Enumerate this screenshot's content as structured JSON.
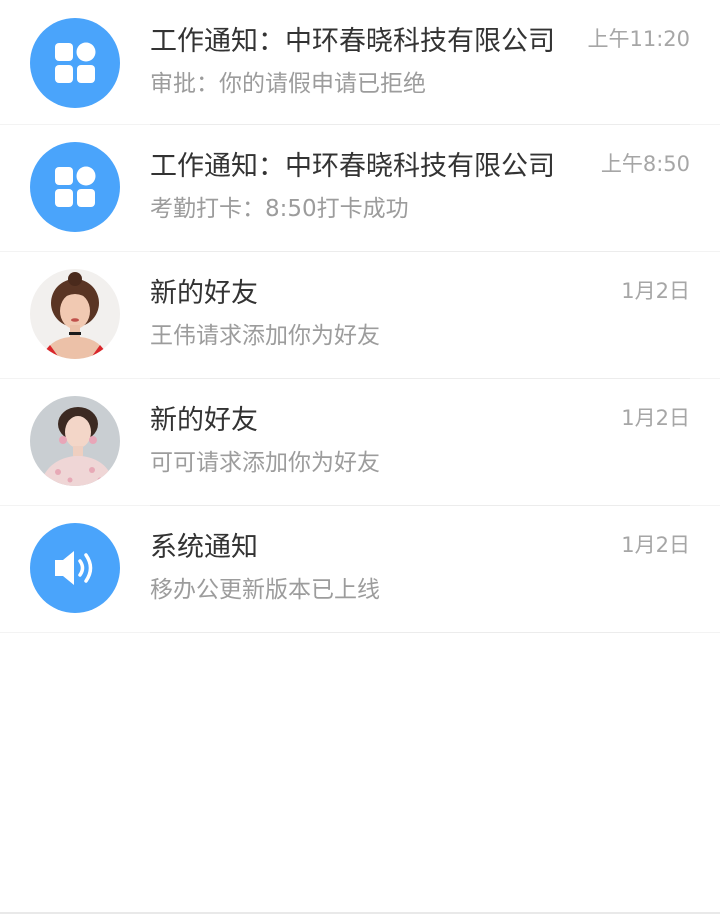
{
  "messages": [
    {
      "title": "工作通知：中环春晓科技有限公司",
      "time": "上午11:20",
      "subtitle": "审批：你的请假申请已拒绝",
      "avatar_icon": "apps-grid-icon",
      "avatar_color": "#4aa4fb"
    },
    {
      "title": "工作通知：中环春晓科技有限公司",
      "time": "上午8:50",
      "subtitle": "考勤打卡：8:50打卡成功",
      "avatar_icon": "apps-grid-icon",
      "avatar_color": "#4aa4fb"
    },
    {
      "title": "新的好友",
      "time": "1月2日",
      "subtitle": "王伟请求添加你为好友",
      "avatar_icon": "user-photo-avatar"
    },
    {
      "title": "新的好友",
      "time": "1月2日",
      "subtitle": "可可请求添加你为好友",
      "avatar_icon": "user-photo-avatar"
    },
    {
      "title": "系统通知",
      "time": "1月2日",
      "subtitle": "移办公更新版本已上线",
      "avatar_icon": "speaker-icon",
      "avatar_color": "#4aa4fb"
    }
  ]
}
